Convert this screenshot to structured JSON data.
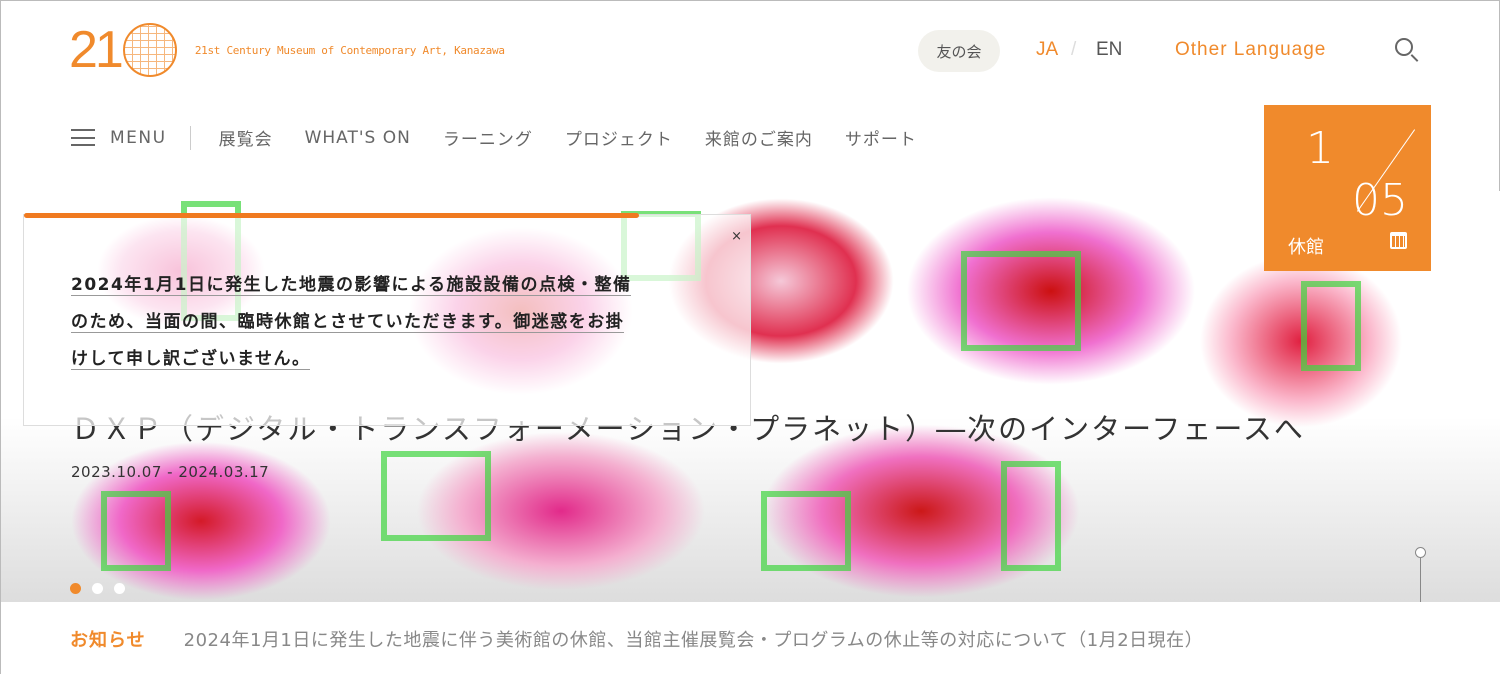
{
  "header": {
    "logo_number": "21",
    "logo_name": "21st Century Museum of Contemporary Art, Kanazawa",
    "members": "友の会",
    "lang_ja": "JA",
    "lang_sep": "/",
    "lang_en": "EN",
    "other_language": "Other Language"
  },
  "nav": {
    "menu": "MENU",
    "items": [
      "展覧会",
      "WHAT'S ON",
      "ラーニング",
      "プロジェクト",
      "来館のご案内",
      "サポート"
    ]
  },
  "date_box": {
    "month": "1",
    "day": "05",
    "status": "休館",
    "icon": "calendar-icon"
  },
  "notice": {
    "lines": [
      "2024年1月1日に発生した地震の影響による施設設備の点検・整備",
      "のため、当面の間、臨時休館とさせていただきます。御迷惑をお掛",
      "けして申し訳ございません。"
    ],
    "close": "×"
  },
  "hero": {
    "title": "ＤＸＰ（デジタル・トランスフォーメーション・プラネット）―次のインターフェースへ",
    "dates": "2023.10.07 - 2024.03.17",
    "slides": 3,
    "active_slide": 1
  },
  "news": {
    "label": "お知らせ",
    "text": "2024年1月1日に発生した地震に伴う美術館の休館、当館主催展覧会・プログラムの休止等の対応について（1月2日現在）"
  },
  "colors": {
    "accent": "#f08a2c"
  }
}
